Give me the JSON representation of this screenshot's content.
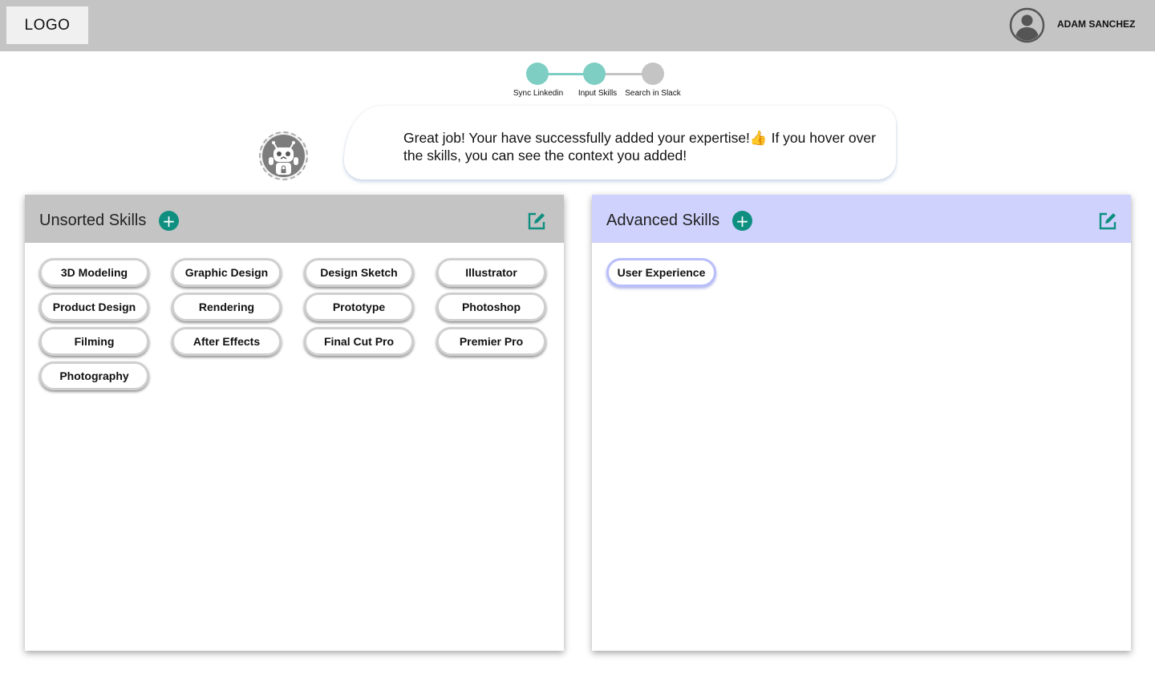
{
  "header": {
    "logo": "LOGO",
    "user_name": "ADAM SANCHEZ"
  },
  "stepper": {
    "steps": [
      {
        "label": "Sync Linkedin",
        "state": "done"
      },
      {
        "label": "Input Skills",
        "state": "done"
      },
      {
        "label": "Search in Slack",
        "state": "pending"
      }
    ],
    "done_color": "#7ecec4",
    "pending_color": "#c4c4c4"
  },
  "assistant": {
    "message_part1": "Great job! Your have successfully added your expertise!",
    "message_emoji": "👍",
    "message_part2": " If you hover over the skills, you can see the context you added!"
  },
  "unsorted": {
    "title": "Unsorted Skills",
    "add_label": "+",
    "header_color": "#c4c4c4",
    "skills": [
      "3D Modeling",
      "Graphic Design",
      "Design Sketch",
      "Illustrator",
      "Product Design",
      "Rendering",
      "Prototype",
      "Photoshop",
      "Filming",
      "After Effects",
      "Final Cut Pro",
      "Premier Pro",
      "Photography"
    ]
  },
  "advanced": {
    "title": "Advanced Skills",
    "add_label": "+",
    "header_color": "#cfd2fd",
    "skills": [
      "User Experience"
    ]
  },
  "colors": {
    "accent": "#0e8f80"
  }
}
